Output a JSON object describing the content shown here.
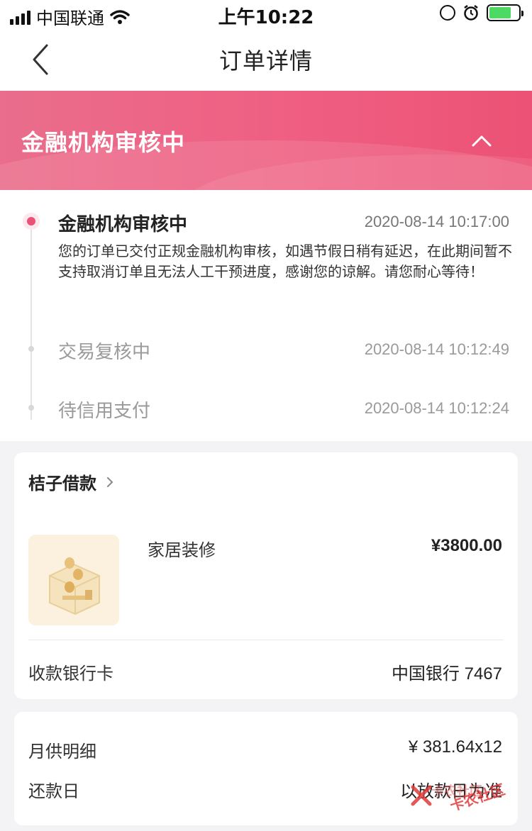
{
  "status_bar": {
    "carrier": "中国联通",
    "time": "上午10:22",
    "battery_level": 0.75
  },
  "nav": {
    "title": "订单详情"
  },
  "banner": {
    "title": "金融机构审核中",
    "colors": {
      "start": "#ea6d8c",
      "end": "#ec5275"
    }
  },
  "timeline": [
    {
      "title": "金融机构审核中",
      "time": "2020-08-14 10:17:00",
      "desc": "您的订单已交付正规金融机构审核，如遇节假日稍有延迟，在此期间暂不支持取消订单且无法人工干预进度，感谢您的谅解。请您耐心等待！",
      "active": true
    },
    {
      "title": "交易复核中",
      "time": "2020-08-14 10:12:49",
      "active": false
    },
    {
      "title": "待信用支付",
      "time": "2020-08-14 10:12:24",
      "active": false
    }
  ],
  "order": {
    "lender": "桔子借款",
    "purpose": "家居装修",
    "amount": "¥3800.00",
    "bank_label": "收款银行卡",
    "bank_value": "中国银行 7467"
  },
  "repayment": {
    "monthly_label": "月供明细",
    "monthly_value": "¥ 381.64x12",
    "due_label": "还款日",
    "due_value": "以放款日为准"
  },
  "watermark": {
    "text1": "卡农社区",
    "text2": "卡农社区"
  },
  "accent": "#ea5378"
}
